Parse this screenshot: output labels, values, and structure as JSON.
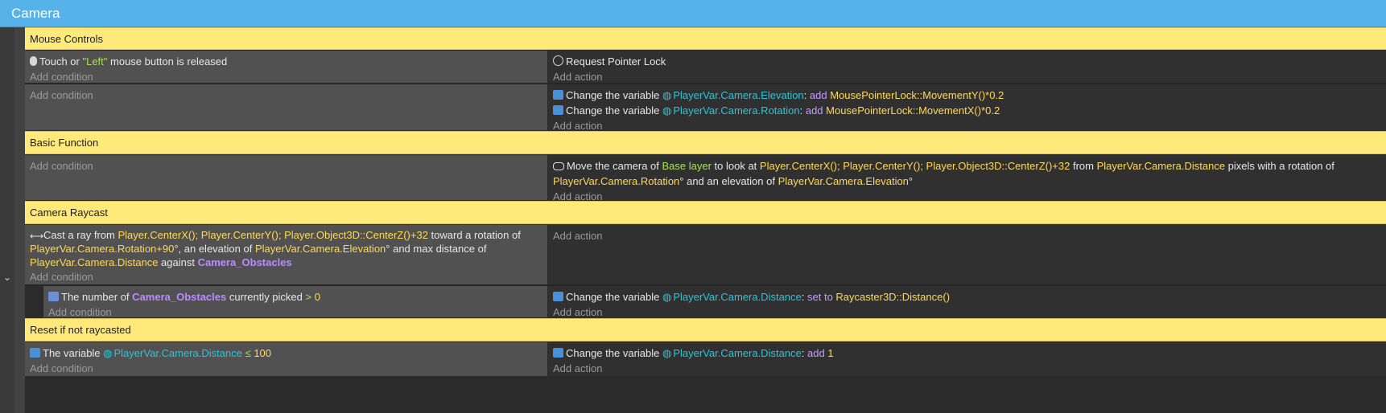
{
  "group": {
    "title": "Camera"
  },
  "collapse_glyph": "⌄",
  "comments": {
    "mouse_controls": "Mouse Controls",
    "basic_function": "Basic Function",
    "camera_raycast": "Camera Raycast",
    "reset": "Reset if not raycasted"
  },
  "common": {
    "add_condition": "Add condition",
    "add_action": "Add action"
  },
  "ev1": {
    "c1": {
      "pre": "Touch or ",
      "button": "\"Left\"",
      "post": " mouse button is released"
    },
    "a1": "Request Pointer Lock"
  },
  "ev2": {
    "a1": {
      "pre": "Change the variable ",
      "var": "PlayerVar.Camera.Elevation",
      "sep": ": ",
      "op": "add",
      "expr": "MousePointerLock::MovementY()*0.2"
    },
    "a2": {
      "pre": "Change the variable ",
      "var": "PlayerVar.Camera.Rotation",
      "sep": ": ",
      "op": "add",
      "expr": "MousePointerLock::MovementX()*0.2"
    }
  },
  "ev3": {
    "a1": {
      "p1": "Move the camera of ",
      "layer": "Base layer",
      "p2": " to look at ",
      "pos": "Player.CenterX(); Player.CenterY(); Player.Object3D::CenterZ()+32",
      "p3": " from ",
      "dist": "PlayerVar.Camera.Distance",
      "p4": " pixels with a rotation of ",
      "rot": "PlayerVar.Camera.Rotation",
      "p5": "° and an elevation of ",
      "elev": "PlayerVar.Camera.Elevation",
      "p6": "°"
    }
  },
  "ev4": {
    "c1": {
      "p1": "Cast a ray from ",
      "pos": "Player.CenterX(); Player.CenterY(); Player.Object3D::CenterZ()+32",
      "p2": " toward a rotation of ",
      "rot": "PlayerVar.Camera.Rotation+90",
      "p3": "°, an elevation of ",
      "elev": "PlayerVar.Camera.Elevation",
      "p4": "° and max distance of ",
      "dist": "PlayerVar.Camera.Distance",
      "p5": " against ",
      "obj": "Camera_Obstacles"
    }
  },
  "ev5": {
    "c1": {
      "p1": "The number of ",
      "obj": "Camera_Obstacles",
      "p2": " currently picked ",
      "op": ">",
      "val": "0"
    },
    "a1": {
      "pre": "Change the variable ",
      "var": "PlayerVar.Camera.Distance",
      "sep": ": ",
      "op": "set to",
      "expr": "Raycaster3D::Distance()"
    }
  },
  "ev6": {
    "c1": {
      "p1": "The variable ",
      "var": "PlayerVar.Camera.Distance",
      "op": "≤",
      "val": "100"
    },
    "a1": {
      "pre": "Change the variable ",
      "var": "PlayerVar.Camera.Distance",
      "sep": ": ",
      "op": "add",
      "expr": "1"
    }
  },
  "colors": {
    "group_header": "#56b2e8",
    "comment": "#ffe97a",
    "condition_panel": "#515151",
    "action_panel": "#303030",
    "variable": "#2ec3d6",
    "expression": "#ffd955",
    "object": "#b98cff",
    "operator": "#c49cff",
    "string": "#a7e05a"
  }
}
